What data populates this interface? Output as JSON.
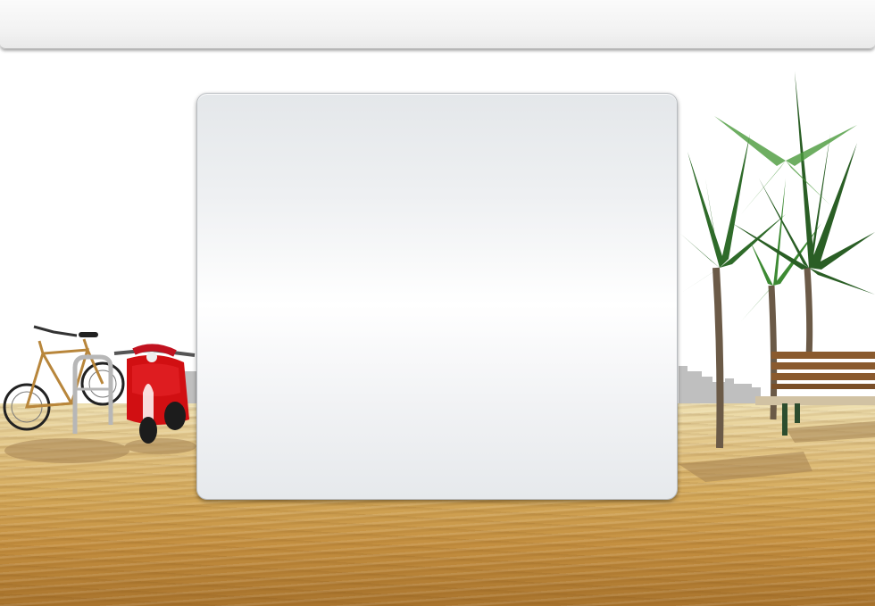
{
  "header": {
    "title": ""
  },
  "panel": {
    "title": ""
  },
  "colors": {
    "top_bar": "#f2f2f2",
    "panel_border": "#b8bcc0",
    "sand": "#d4a95a",
    "scooter": "#d10f12",
    "palm": "#2f6b2a",
    "bench": "#8a5a2e"
  }
}
